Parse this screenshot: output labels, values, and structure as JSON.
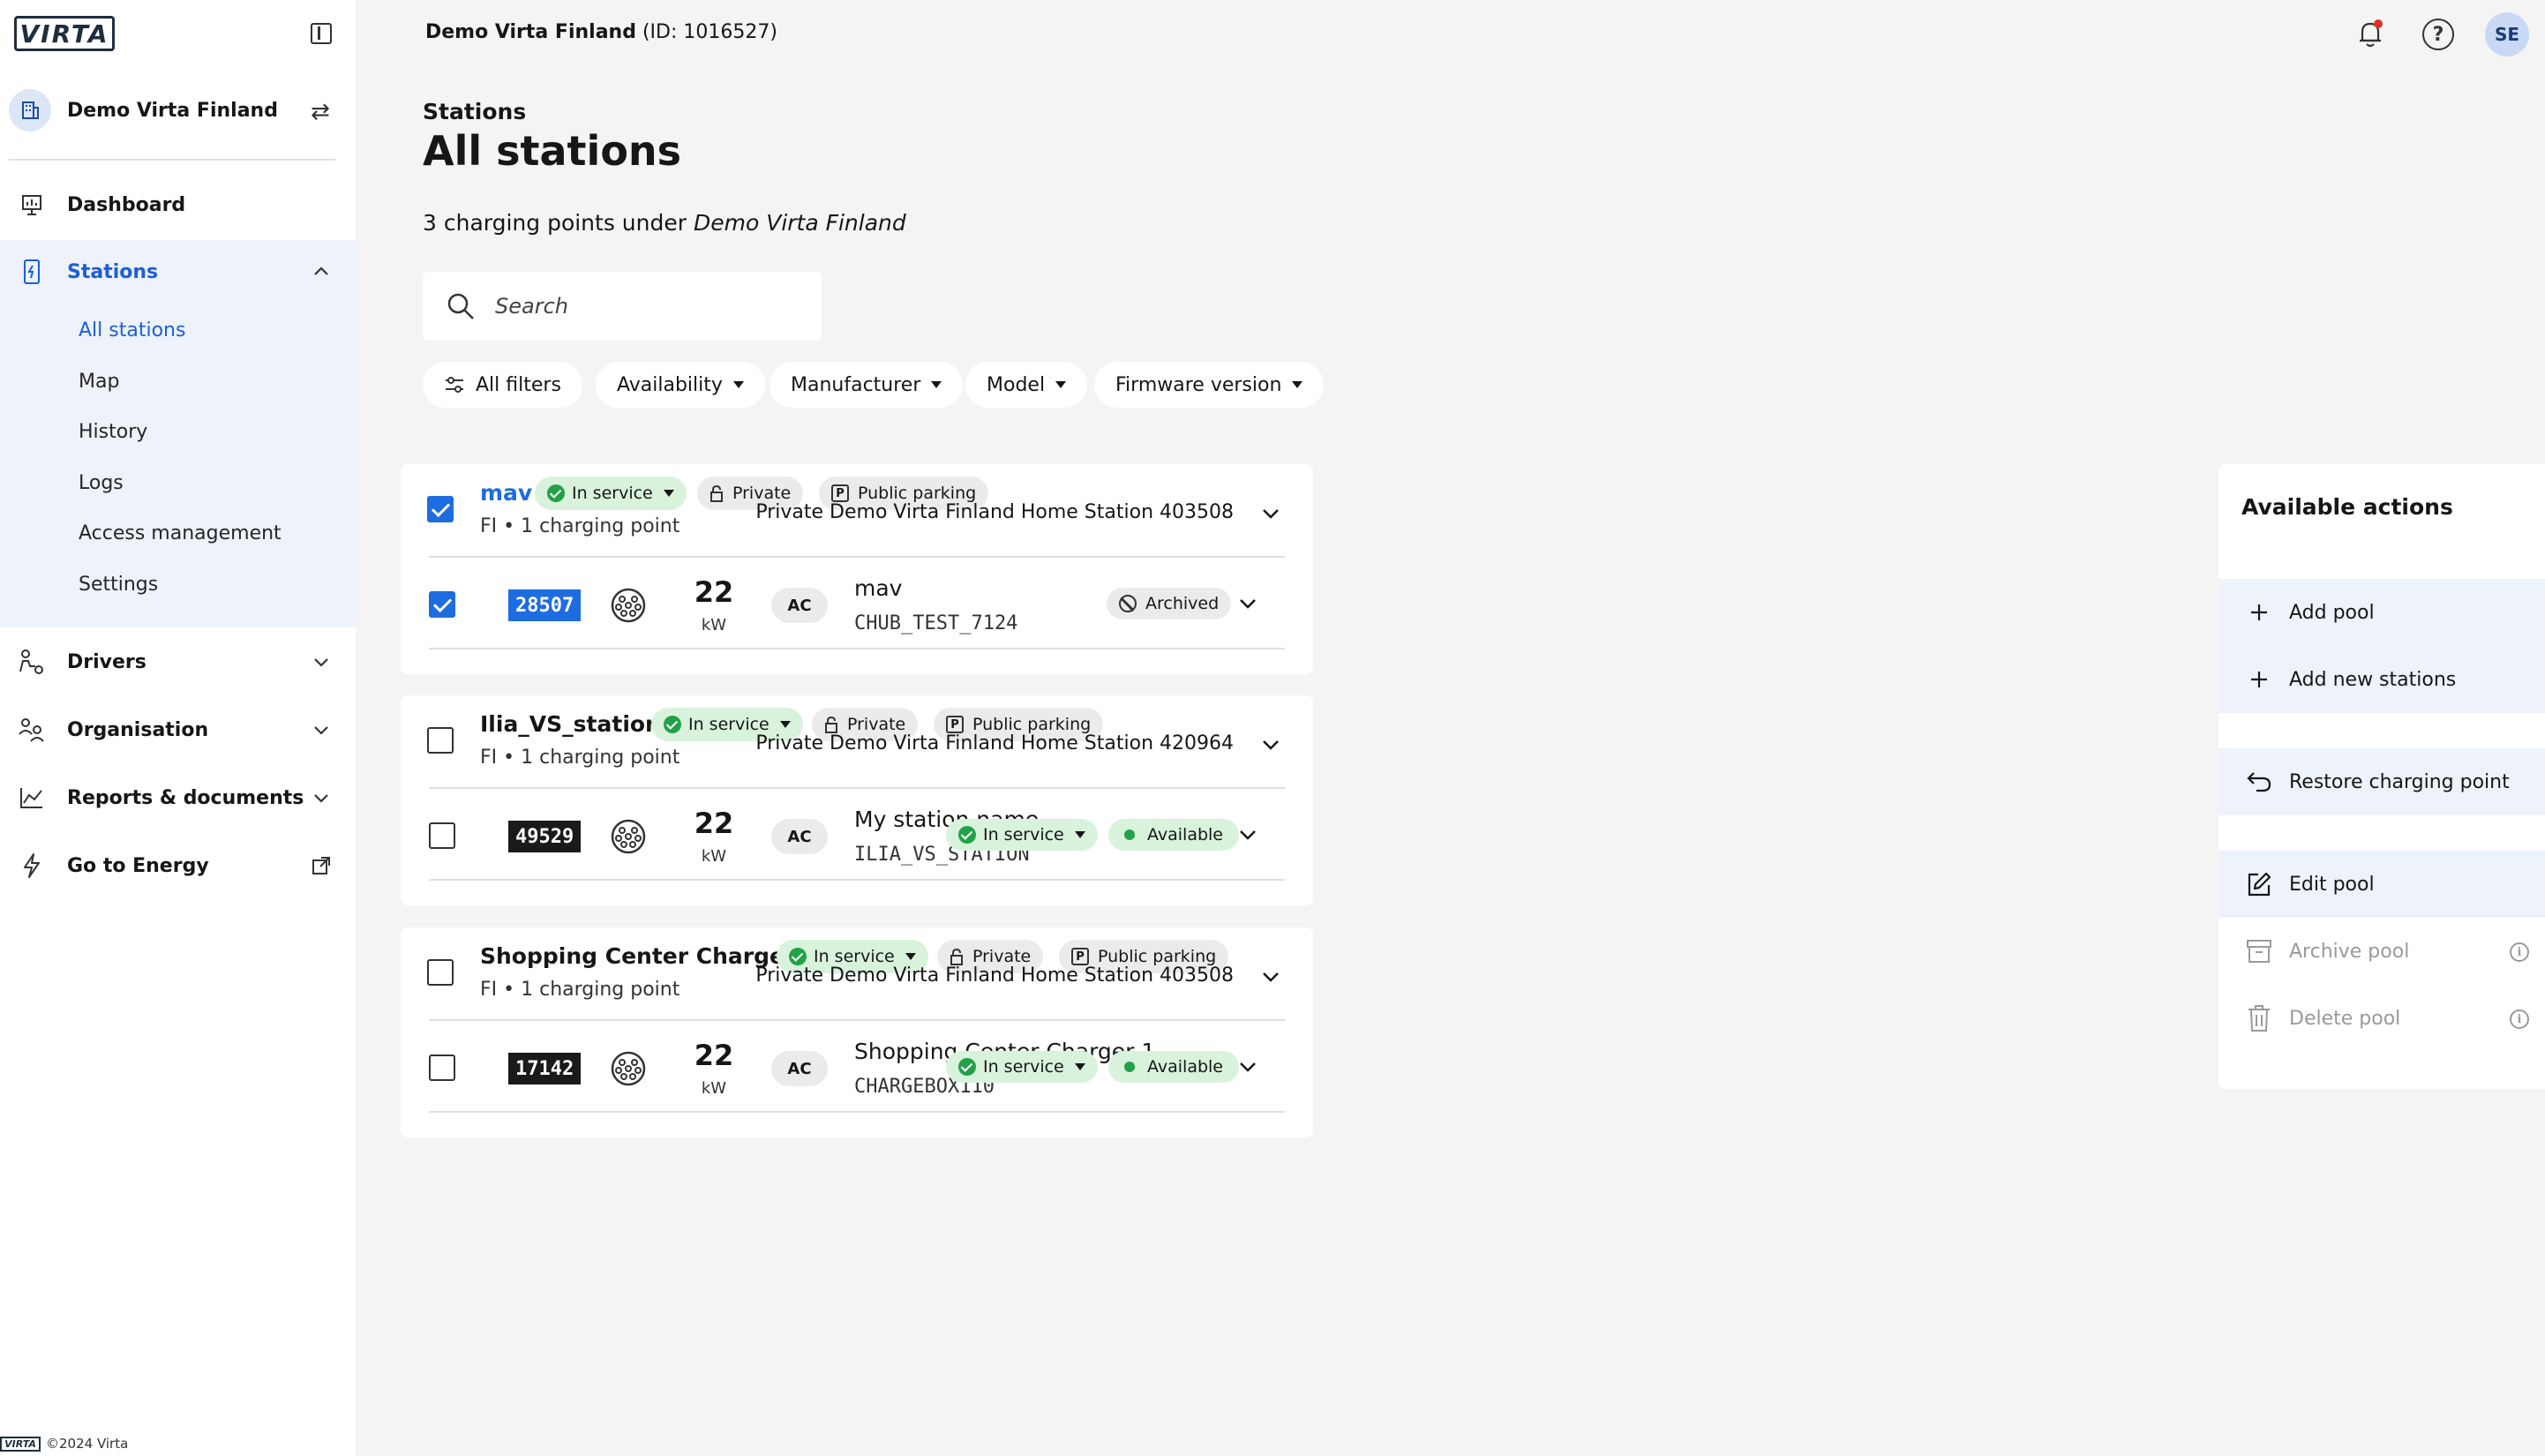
{
  "brand": {
    "logo_text": "VIRTA",
    "copyright": "©2024 Virta"
  },
  "sidebar": {
    "org_name": "Demo Virta Finland",
    "items": [
      {
        "label": "Dashboard",
        "icon": "dashboard-icon"
      },
      {
        "label": "Stations",
        "icon": "station-icon",
        "expanded": true
      },
      {
        "label": "Drivers",
        "icon": "drivers-icon"
      },
      {
        "label": "Organisation",
        "icon": "organisation-icon"
      },
      {
        "label": "Reports & documents",
        "icon": "reports-icon"
      },
      {
        "label": "Go to Energy",
        "icon": "energy-icon"
      }
    ],
    "station_sub_items": [
      "All stations",
      "Map",
      "History",
      "Logs",
      "Access management",
      "Settings"
    ]
  },
  "header": {
    "org_title": "Demo Virta Finland",
    "org_id": "(ID: 1016527)",
    "user_initials": "SE"
  },
  "page": {
    "breadcrumb": "Stations",
    "title": "All stations",
    "count_prefix": "3 charging points under",
    "count_org": "Demo Virta Finland",
    "search_placeholder": "Search"
  },
  "filters": [
    "All filters",
    "Availability",
    "Manufacturer",
    "Model",
    "Firmware version"
  ],
  "pools": [
    {
      "name": "mav",
      "selected": true,
      "status": "In service",
      "tags": [
        "Private",
        "Public parking"
      ],
      "subtitle": "FI • 1 charging point",
      "station_label": "Private Demo Virta Finland Home Station 403508",
      "charging_point": {
        "id": "28507",
        "selected": true,
        "kw": "22",
        "kw_unit": "kW",
        "current": "AC",
        "name": "mav",
        "code": "CHUB_TEST_7124",
        "badges": [
          "Archived"
        ]
      }
    },
    {
      "name": "Ilia_VS_station",
      "selected": false,
      "status": "In service",
      "tags": [
        "Private",
        "Public parking"
      ],
      "subtitle": "FI • 1 charging point",
      "station_label": "Private Demo Virta Finland Home Station 420964",
      "charging_point": {
        "id": "49529",
        "selected": false,
        "kw": "22",
        "kw_unit": "kW",
        "current": "AC",
        "name": "My station name",
        "code": "ILIA_VS_STATION",
        "badges": [
          "In service",
          "Available"
        ]
      }
    },
    {
      "name": "Shopping Center Charger 1",
      "selected": false,
      "status": "In service",
      "tags": [
        "Private",
        "Public parking"
      ],
      "subtitle": "FI • 1 charging point",
      "station_label": "Private Demo Virta Finland Home Station 403508",
      "charging_point": {
        "id": "17142",
        "selected": false,
        "kw": "22",
        "kw_unit": "kW",
        "current": "AC",
        "name": "Shopping Center Charger 1",
        "code": "CHARGEBOX110",
        "badges": [
          "In service",
          "Available"
        ]
      }
    }
  ],
  "actions": {
    "title": "Available actions",
    "items": [
      {
        "label": "Add pool",
        "enabled": true
      },
      {
        "label": "Add new stations",
        "enabled": true
      },
      {
        "label": "Restore charging point",
        "enabled": true
      },
      {
        "label": "Edit pool",
        "enabled": true
      },
      {
        "label": "Archive pool",
        "enabled": false
      },
      {
        "label": "Delete pool",
        "enabled": false
      }
    ]
  },
  "colors": {
    "accent": "#1d6ce0",
    "success": "#24a148",
    "selected_nav_bg": "#edf2fb"
  }
}
